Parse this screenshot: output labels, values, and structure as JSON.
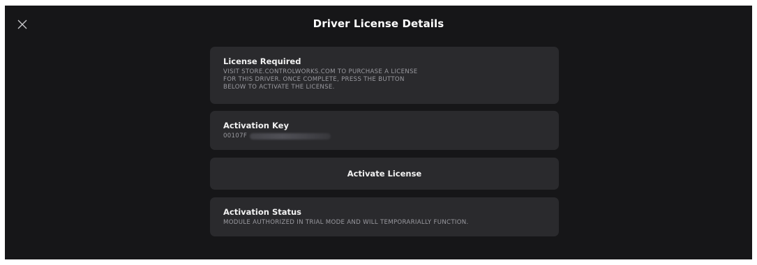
{
  "header": {
    "title": "Driver License Details",
    "close_icon": "close-icon"
  },
  "license_required": {
    "heading": "License Required",
    "text": "VISIT STORE.CONTROLWORKS.COM TO PURCHASE A LICENSE\nFOR THIS DRIVER. ONCE COMPLETE, PRESS THE BUTTON\nBELOW TO ACTIVATE THE LICENSE."
  },
  "activation_key": {
    "heading": "Activation Key",
    "value_visible": "00107F"
  },
  "activate_button": {
    "label": "Activate License"
  },
  "activation_status": {
    "heading": "Activation Status",
    "text": "MODULE AUTHORIZED IN TRIAL MODE AND WILL TEMPORARIALLY FUNCTION."
  },
  "colors": {
    "background": "#161618",
    "card": "#2a2a2d",
    "secondary_text": "#9a9aa0"
  }
}
